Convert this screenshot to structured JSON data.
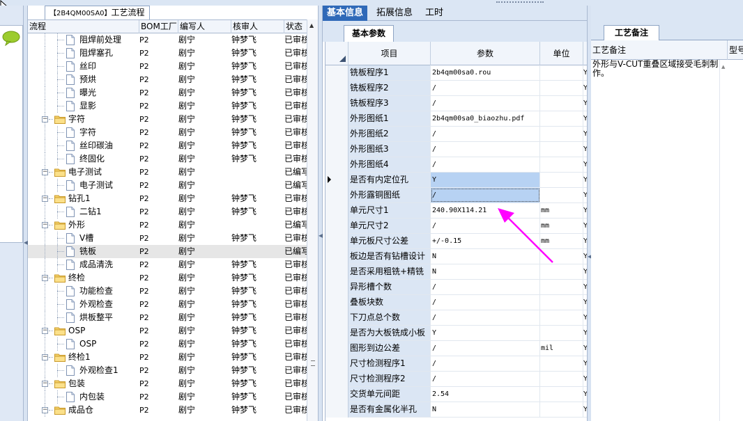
{
  "colors": {
    "accent_tab": "#2f69b8",
    "annotation_arrow": "#ff00ff",
    "selection_highlight": "#b7d2f3",
    "panel_header": "#dbe6f4"
  },
  "left_panel": {
    "tab_code": "【2B4QM00SA0】",
    "tab_title": "工艺流程",
    "columns": {
      "flow": "流程",
      "bom": "BOM工厂",
      "editor": "编写人",
      "reviewer": "核审人",
      "status": "状态"
    },
    "rows": [
      {
        "name": "阻焊前处理",
        "bom": "P2",
        "editor": "剧宁",
        "reviewer": "钟梦飞",
        "status": "已审核",
        "level": 1,
        "icon": "doc-icon"
      },
      {
        "name": "阻焊塞孔",
        "bom": "P2",
        "editor": "剧宁",
        "reviewer": "钟梦飞",
        "status": "已审核",
        "level": 1,
        "icon": "doc-icon"
      },
      {
        "name": "丝印",
        "bom": "P2",
        "editor": "剧宁",
        "reviewer": "钟梦飞",
        "status": "已审核",
        "level": 1,
        "icon": "doc-icon"
      },
      {
        "name": "预烘",
        "bom": "P2",
        "editor": "剧宁",
        "reviewer": "钟梦飞",
        "status": "已审核",
        "level": 1,
        "icon": "doc-icon"
      },
      {
        "name": "曝光",
        "bom": "P2",
        "editor": "剧宁",
        "reviewer": "钟梦飞",
        "status": "已审核",
        "level": 1,
        "icon": "doc-icon"
      },
      {
        "name": "显影",
        "bom": "P2",
        "editor": "剧宁",
        "reviewer": "钟梦飞",
        "status": "已审核",
        "level": 1,
        "icon": "doc-icon"
      },
      {
        "name": "字符",
        "bom": "P2",
        "editor": "剧宁",
        "reviewer": "钟梦飞",
        "status": "已审核",
        "level": 0,
        "icon": "folder-icon"
      },
      {
        "name": "字符",
        "bom": "P2",
        "editor": "剧宁",
        "reviewer": "钟梦飞",
        "status": "已审核",
        "level": 1,
        "icon": "doc-icon"
      },
      {
        "name": "丝印碳油",
        "bom": "P2",
        "editor": "剧宁",
        "reviewer": "钟梦飞",
        "status": "已审核",
        "level": 1,
        "icon": "doc-icon"
      },
      {
        "name": "终固化",
        "bom": "P2",
        "editor": "剧宁",
        "reviewer": "钟梦飞",
        "status": "已审核",
        "level": 1,
        "icon": "doc-icon"
      },
      {
        "name": "电子测试",
        "bom": "P2",
        "editor": "剧宁",
        "reviewer": "",
        "status": "已编写",
        "level": 0,
        "icon": "folder-icon"
      },
      {
        "name": "电子测试",
        "bom": "P2",
        "editor": "剧宁",
        "reviewer": "",
        "status": "已编写",
        "level": 1,
        "icon": "doc-icon"
      },
      {
        "name": "钻孔1",
        "bom": "P2",
        "editor": "剧宁",
        "reviewer": "钟梦飞",
        "status": "已审核",
        "level": 0,
        "icon": "folder-icon"
      },
      {
        "name": "二钻1",
        "bom": "P2",
        "editor": "剧宁",
        "reviewer": "钟梦飞",
        "status": "已审核",
        "level": 1,
        "icon": "doc-icon"
      },
      {
        "name": "外形",
        "bom": "P2",
        "editor": "剧宁",
        "reviewer": "",
        "status": "已编写",
        "level": 0,
        "icon": "folder-icon"
      },
      {
        "name": "V槽",
        "bom": "P2",
        "editor": "剧宁",
        "reviewer": "钟梦飞",
        "status": "已审核",
        "level": 1,
        "icon": "doc-icon"
      },
      {
        "name": "铣板",
        "bom": "P2",
        "editor": "剧宁",
        "reviewer": "",
        "status": "已编写",
        "level": 1,
        "icon": "doc-icon",
        "selected": true
      },
      {
        "name": "成品清洗",
        "bom": "P2",
        "editor": "剧宁",
        "reviewer": "钟梦飞",
        "status": "已审核",
        "level": 1,
        "icon": "doc-icon"
      },
      {
        "name": "终检",
        "bom": "P2",
        "editor": "剧宁",
        "reviewer": "钟梦飞",
        "status": "已审核",
        "level": 0,
        "icon": "folder-icon"
      },
      {
        "name": "功能检查",
        "bom": "P2",
        "editor": "剧宁",
        "reviewer": "钟梦飞",
        "status": "已审核",
        "level": 1,
        "icon": "doc-icon"
      },
      {
        "name": "外观检查",
        "bom": "P2",
        "editor": "剧宁",
        "reviewer": "钟梦飞",
        "status": "已审核",
        "level": 1,
        "icon": "doc-icon"
      },
      {
        "name": "烘板整平",
        "bom": "P2",
        "editor": "剧宁",
        "reviewer": "钟梦飞",
        "status": "已审核",
        "level": 1,
        "icon": "doc-icon"
      },
      {
        "name": "OSP",
        "bom": "P2",
        "editor": "剧宁",
        "reviewer": "钟梦飞",
        "status": "已审核",
        "level": 0,
        "icon": "folder-icon"
      },
      {
        "name": "OSP",
        "bom": "P2",
        "editor": "剧宁",
        "reviewer": "钟梦飞",
        "status": "已审核",
        "level": 1,
        "icon": "doc-icon"
      },
      {
        "name": "终检1",
        "bom": "P2",
        "editor": "剧宁",
        "reviewer": "钟梦飞",
        "status": "已审核",
        "level": 0,
        "icon": "folder-icon"
      },
      {
        "name": "外观检查1",
        "bom": "P2",
        "editor": "剧宁",
        "reviewer": "钟梦飞",
        "status": "已审核",
        "level": 1,
        "icon": "doc-icon"
      },
      {
        "name": "包装",
        "bom": "P2",
        "editor": "剧宁",
        "reviewer": "钟梦飞",
        "status": "已审核",
        "level": 0,
        "icon": "folder-icon"
      },
      {
        "name": "内包装",
        "bom": "P2",
        "editor": "剧宁",
        "reviewer": "钟梦飞",
        "status": "已审核",
        "level": 1,
        "icon": "doc-icon"
      },
      {
        "name": "成品仓",
        "bom": "P2",
        "editor": "剧宁",
        "reviewer": "钟梦飞",
        "status": "已审核",
        "level": 0,
        "icon": "folder-icon"
      }
    ]
  },
  "middle_panel": {
    "tabs": [
      "基本信息",
      "拓展信息",
      "工时"
    ],
    "subtab": "基本参数",
    "columns": {
      "item": "项目",
      "param": "参数",
      "unit": "单位"
    },
    "rows": [
      {
        "item": "铣板程序1",
        "param": "2b4qm00sa0.rou",
        "unit": ""
      },
      {
        "item": "铣板程序2",
        "param": "/",
        "unit": ""
      },
      {
        "item": "铣板程序3",
        "param": "/",
        "unit": ""
      },
      {
        "item": "外形图纸1",
        "param": "2b4qm00sa0_biaozhu.pdf",
        "unit": ""
      },
      {
        "item": "外形图纸2",
        "param": "/",
        "unit": ""
      },
      {
        "item": "外形图纸3",
        "param": "/",
        "unit": ""
      },
      {
        "item": "外形图纸4",
        "param": "/",
        "unit": ""
      },
      {
        "item": "是否有内定位孔",
        "param": "Y",
        "unit": "",
        "current": true
      },
      {
        "item": "外形露铜图纸",
        "param": "/",
        "unit": "",
        "focused": true
      },
      {
        "item": "单元尺寸1",
        "param": "240.90X114.21",
        "unit": "mm"
      },
      {
        "item": "单元尺寸2",
        "param": "/",
        "unit": "mm"
      },
      {
        "item": "单元板尺寸公差",
        "param": "+/-0.15",
        "unit": "mm"
      },
      {
        "item": "板边是否有钻槽设计",
        "param": "N",
        "unit": ""
      },
      {
        "item": "是否采用粗铣+精铣",
        "param": "N",
        "unit": ""
      },
      {
        "item": "异形槽个数",
        "param": "/",
        "unit": ""
      },
      {
        "item": "叠板块数",
        "param": "/",
        "unit": ""
      },
      {
        "item": "下刀点总个数",
        "param": "/",
        "unit": ""
      },
      {
        "item": "是否为大板铣成小板",
        "param": "Y",
        "unit": ""
      },
      {
        "item": "图形到边公差",
        "param": "/",
        "unit": "mil"
      },
      {
        "item": "尺寸检测程序1",
        "param": "/",
        "unit": ""
      },
      {
        "item": "尺寸检测程序2",
        "param": "/",
        "unit": ""
      },
      {
        "item": "交货单元间距",
        "param": "2.54",
        "unit": ""
      },
      {
        "item": "是否有金属化半孔",
        "param": "N",
        "unit": ""
      }
    ],
    "edge_marker": "Y"
  },
  "right_panel": {
    "tab": "工艺备注",
    "columns": {
      "note": "工艺备注",
      "model": "型号"
    },
    "note_text": "外形与V-CUT重叠区域接受毛刺制作。"
  }
}
